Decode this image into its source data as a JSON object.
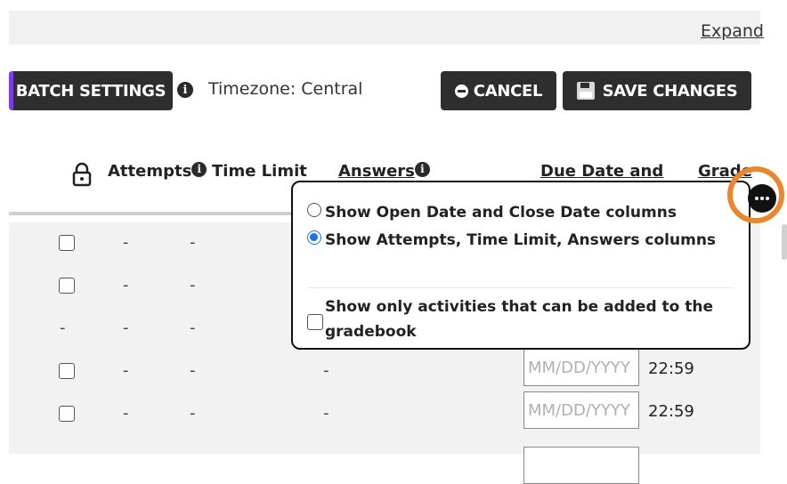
{
  "top": {
    "expand_label": "Expand"
  },
  "toolbar": {
    "batch_settings_label": "BATCH SETTINGS",
    "timezone_label": "Timezone: Central",
    "cancel_label": "CANCEL",
    "save_label": "SAVE CHANGES"
  },
  "columns": {
    "attempts": "Attempts",
    "time_limit": "Time Limit",
    "answers": "Answers",
    "due_date": "Due Date and",
    "grade": "Grade"
  },
  "rows": [
    {
      "checkbox": true,
      "attempts": "-",
      "time_limit": "-",
      "answers": "",
      "date_placeholder": "",
      "time": ""
    },
    {
      "checkbox": true,
      "attempts": "-",
      "time_limit": "-",
      "answers": "",
      "date_placeholder": "",
      "time": ""
    },
    {
      "checkbox": false,
      "lock": "-",
      "attempts": "-",
      "time_limit": "-",
      "answers": "",
      "date_placeholder": "",
      "time": ""
    },
    {
      "checkbox": true,
      "attempts": "-",
      "time_limit": "-",
      "answers": "-",
      "date_placeholder": "MM/DD/YYYY",
      "time": "22:59"
    },
    {
      "checkbox": true,
      "attempts": "-",
      "time_limit": "-",
      "answers": "-",
      "date_placeholder": "MM/DD/YYYY",
      "time": "22:59"
    }
  ],
  "popup": {
    "option_open_close": "Show Open Date and Close Date columns",
    "option_attempts": "Show Attempts, Time Limit, Answers columns",
    "option_gradebook": "Show only activities that can be added to the gradebook",
    "selected": "attempts"
  },
  "colors": {
    "accent_ring": "#e8872b",
    "radio_selected": "#1a73e8",
    "batch_accent": "#7c3aed"
  }
}
